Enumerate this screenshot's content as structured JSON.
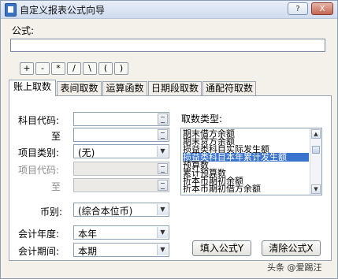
{
  "window": {
    "title": "自定义报表公式向导",
    "help_button": "?",
    "close_button": "X"
  },
  "formula": {
    "label": "公式:",
    "value": ""
  },
  "operators": [
    "+",
    "-",
    "*",
    "/",
    "\\",
    "(",
    ")"
  ],
  "tabs": [
    "账上取数",
    "表间取数",
    "运算函数",
    "日期段取数",
    "通配符取数"
  ],
  "form": {
    "subject_code_label": "科目代码:",
    "to_label": "至",
    "item_type_label": "项目类别:",
    "item_type_value": "(无)",
    "item_code_label": "项目代码:",
    "item_to_label": "至",
    "currency_label": "币别:",
    "currency_value": "(综合本位币)",
    "year_label": "会计年度:",
    "year_value": "本年",
    "period_label": "会计期间:",
    "period_value": "本期"
  },
  "fetch_type": {
    "label": "取数类型:",
    "items": [
      "期末借方余额",
      "期末贷方余额",
      "损益类科目实际发生额",
      "损益类科目本年累计发生额",
      "预算数",
      "累计预算数",
      "折本币期初余额",
      "折本币期初借方余额"
    ],
    "selected_index": 3
  },
  "buttons": {
    "fill_formula": "填入公式Y",
    "clear_formula": "清除公式X"
  },
  "watermark": "头条 @爱踢汪"
}
